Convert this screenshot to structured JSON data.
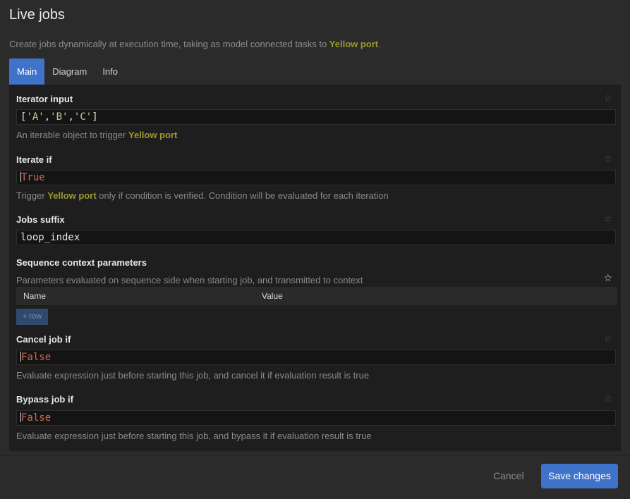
{
  "dialog": {
    "title": "Live jobs",
    "description_prefix": "Create jobs dynamically at execution time, taking as model connected tasks to ",
    "description_highlight": "Yellow port",
    "description_suffix": "."
  },
  "tabs": [
    {
      "label": "Main",
      "active": true
    },
    {
      "label": "Diagram",
      "active": false
    },
    {
      "label": "Info",
      "active": false
    }
  ],
  "fields": {
    "iterator_input": {
      "label": "Iterator input",
      "value_tokens": [
        "[",
        "'A'",
        ",",
        "'B'",
        ",",
        "'C'",
        "]"
      ],
      "help_prefix": "An iterable object to trigger ",
      "help_highlight": "Yellow port"
    },
    "iterate_if": {
      "label": "Iterate if",
      "value": "True",
      "help_prefix": "Trigger ",
      "help_highlight": "Yellow port",
      "help_suffix": " only if condition is verified. Condition will be evaluated for each iteration"
    },
    "jobs_suffix": {
      "label": "Jobs suffix",
      "value": "loop_index"
    },
    "sequence_context": {
      "label": "Sequence context parameters",
      "help": "Parameters evaluated on sequence side when starting job, and transmitted to context",
      "columns": [
        "Name",
        "Value"
      ],
      "add_row_label": "+ row"
    },
    "cancel_job_if": {
      "label": "Cancel job if",
      "value": "False",
      "help": "Evaluate expression just before starting this job, and cancel it if evaluation result is true"
    },
    "bypass_job_if": {
      "label": "Bypass job if",
      "value": "False",
      "help": "Evaluate expression just before starting this job, and bypass it if evaluation result is true"
    }
  },
  "footer": {
    "cancel_label": "Cancel",
    "save_label": "Save changes"
  },
  "icons": {
    "favorite": "star-icon"
  },
  "colors": {
    "accent": "#3f73c9",
    "highlight": "#9a9a2e",
    "keyword": "#d06a4c"
  }
}
